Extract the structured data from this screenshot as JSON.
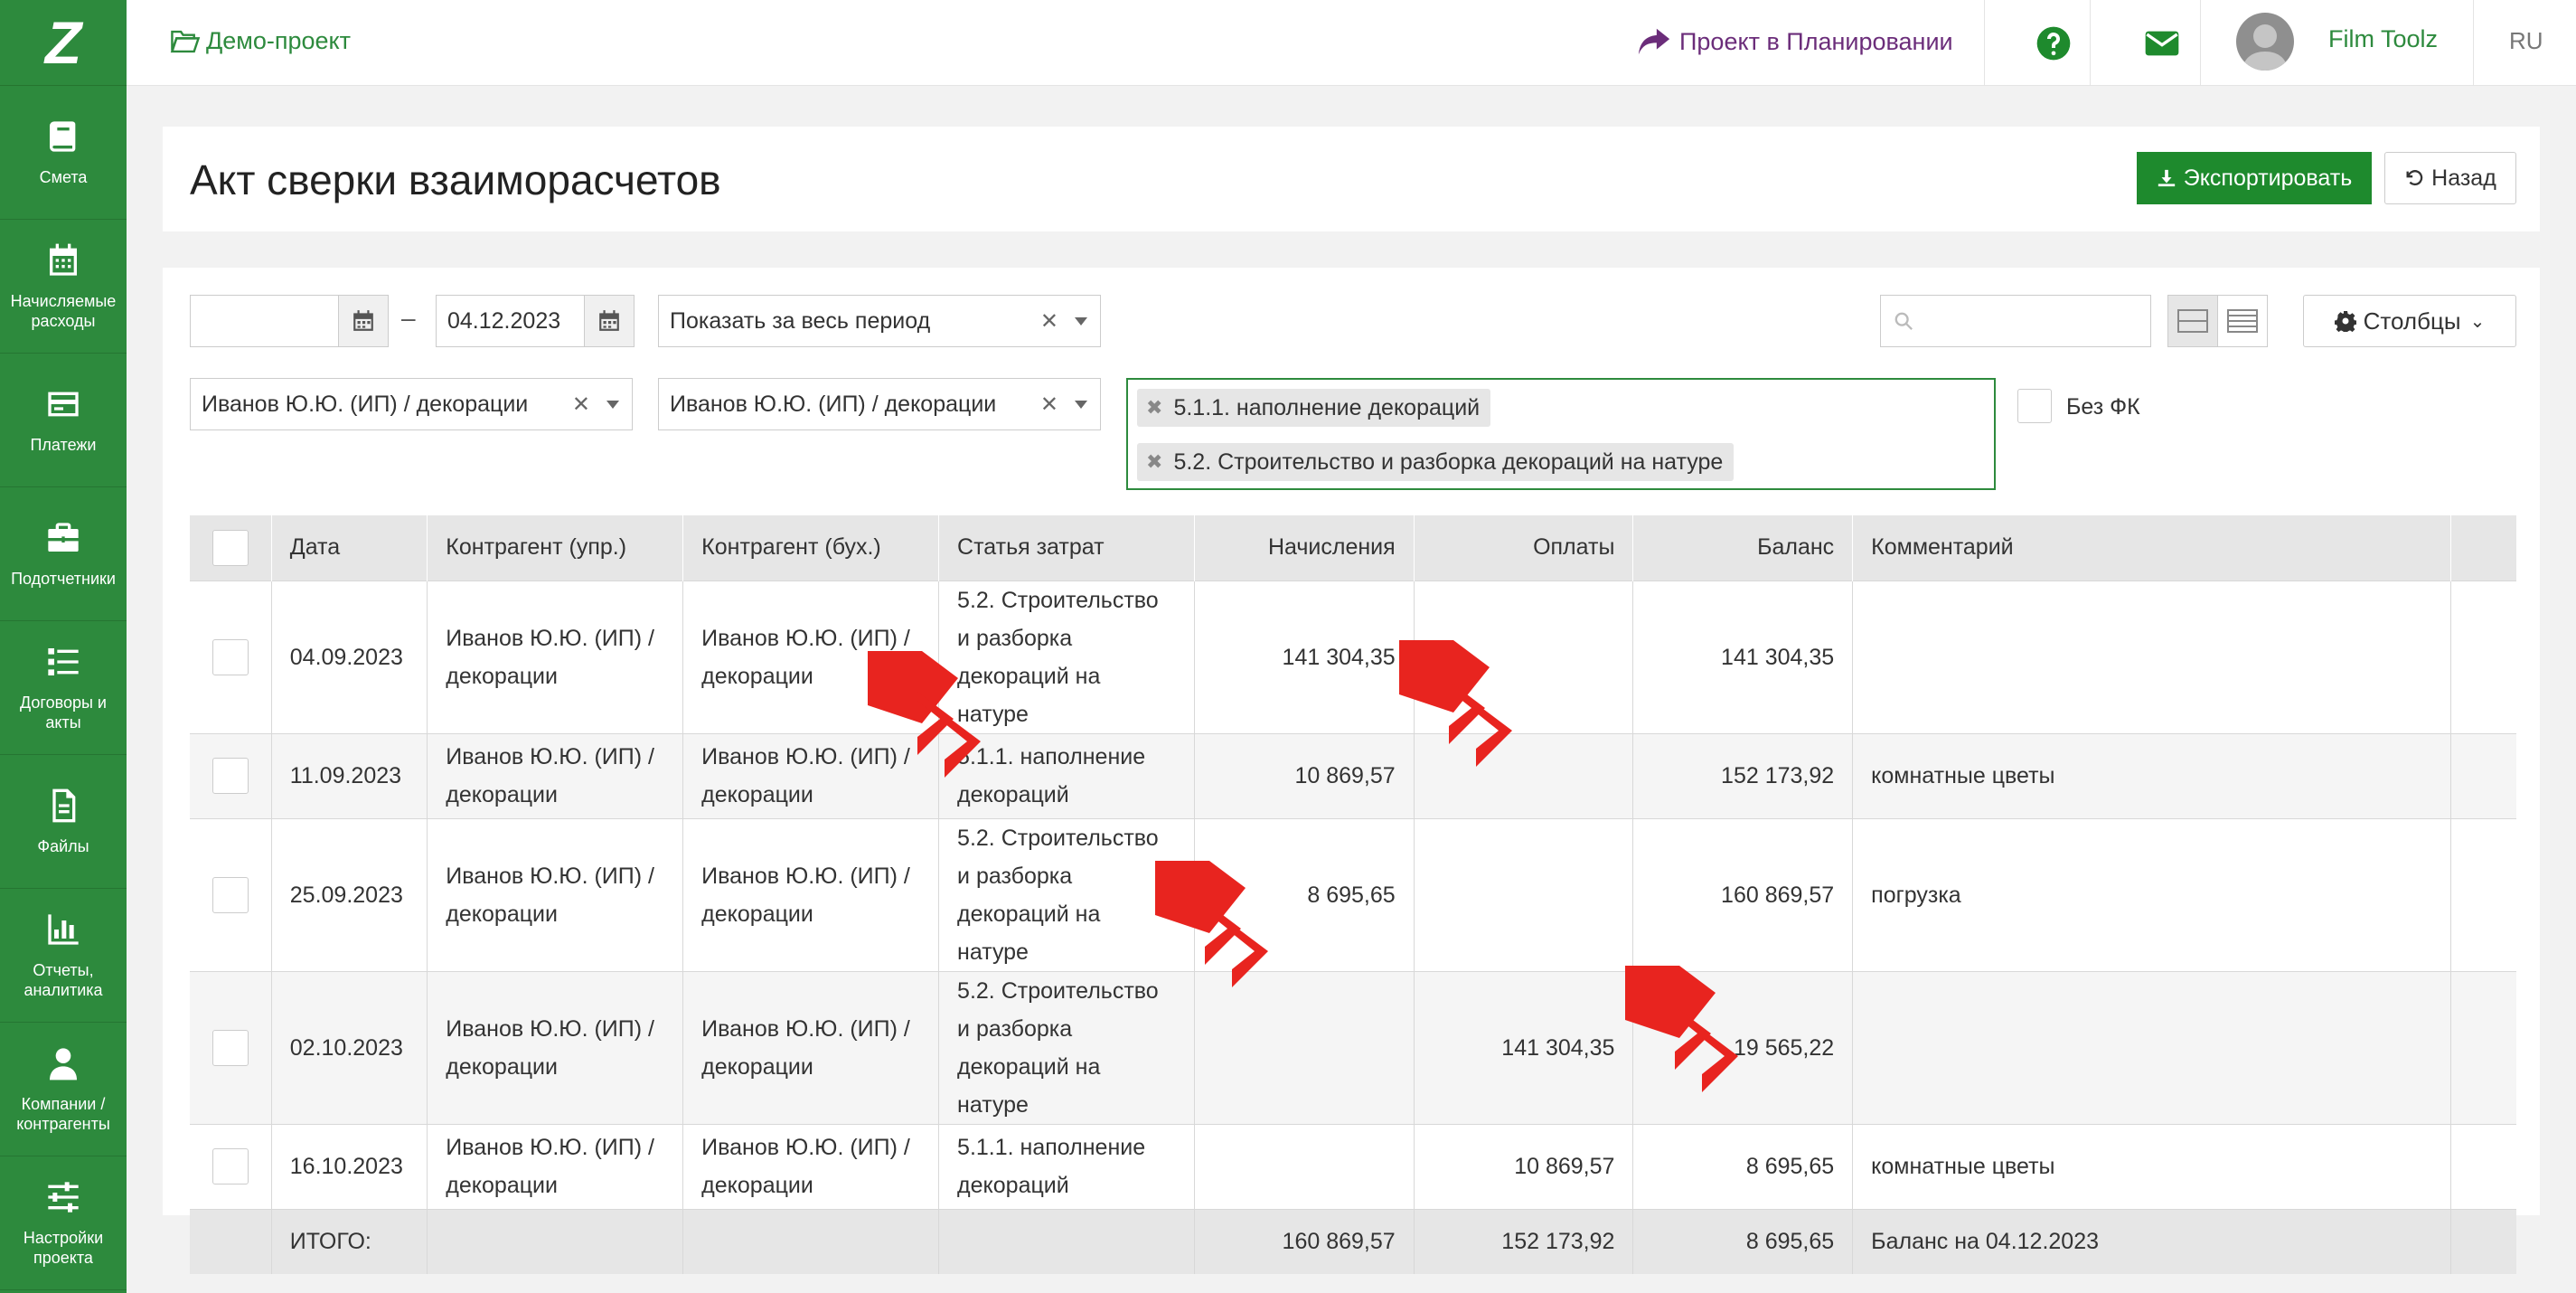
{
  "app": {
    "logo": "Z"
  },
  "sidebar": {
    "items": [
      {
        "label": "Смета",
        "icon": "book-icon"
      },
      {
        "label": "Начисляемые\nрасходы",
        "icon": "calendar-icon"
      },
      {
        "label": "Платежи",
        "icon": "card-icon"
      },
      {
        "label": "Подотчетники",
        "icon": "briefcase-icon"
      },
      {
        "label": "Договоры и\nакты",
        "icon": "list-icon"
      },
      {
        "label": "Файлы",
        "icon": "file-icon"
      },
      {
        "label": "Отчеты,\nаналитика",
        "icon": "chart-icon"
      },
      {
        "label": "Компании /\nконтрагенты",
        "icon": "user-icon"
      },
      {
        "label": "Настройки\nпроекта",
        "icon": "sliders-icon"
      }
    ]
  },
  "topbar": {
    "project": "Демо-проект",
    "status": "Проект в Планировании",
    "user": "Film Toolz",
    "lang": "RU"
  },
  "page": {
    "title": "Акт сверки взаиморасчетов",
    "export_label": "Экспортировать",
    "back_label": "Назад"
  },
  "filters": {
    "date_from": "",
    "date_to": "04.12.2023",
    "period": "Показать за весь период",
    "contractor_mgmt": "Иванов Ю.Ю. (ИП) / декорации",
    "contractor_acc": "Иванов Ю.Ю. (ИП) / декорации",
    "cost_items": [
      "5.1.1. наполнение декораций",
      "5.2. Строительство и разборка декораций на натуре"
    ],
    "no_fk_label": "Без ФК",
    "search_placeholder": "",
    "columns_label": "Столбцы"
  },
  "table": {
    "headers": [
      "Дата",
      "Контрагент (упр.)",
      "Контрагент (бух.)",
      "Статья затрат",
      "Начисления",
      "Оплаты",
      "Баланс",
      "Комментарий"
    ],
    "rows": [
      {
        "date": "04.09.2023",
        "c_mgmt": "Иванов Ю.Ю. (ИП) / декорации",
        "c_acc": "Иванов Ю.Ю. (ИП) / декорации",
        "item": "5.2. Строительство и разборка декораций на натуре",
        "accr": "141 304,35",
        "pay": "",
        "bal": "141 304,35",
        "comment": ""
      },
      {
        "date": "11.09.2023",
        "c_mgmt": "Иванов Ю.Ю. (ИП) / декорации",
        "c_acc": "Иванов Ю.Ю. (ИП) / декорации",
        "item": "5.1.1. наполнение декораций",
        "accr": "10 869,57",
        "pay": "",
        "bal": "152 173,92",
        "comment": "комнатные цветы"
      },
      {
        "date": "25.09.2023",
        "c_mgmt": "Иванов Ю.Ю. (ИП) / декорации",
        "c_acc": "Иванов Ю.Ю. (ИП) / декорации",
        "item": "5.2. Строительство и разборка декораций на натуре",
        "accr": "8 695,65",
        "pay": "",
        "bal": "160 869,57",
        "comment": "погрузка"
      },
      {
        "date": "02.10.2023",
        "c_mgmt": "Иванов Ю.Ю. (ИП) / декорации",
        "c_acc": "Иванов Ю.Ю. (ИП) / декорации",
        "item": "5.2. Строительство и разборка декораций на натуре",
        "accr": "",
        "pay": "141 304,35",
        "bal": "19 565,22",
        "comment": ""
      },
      {
        "date": "16.10.2023",
        "c_mgmt": "Иванов Ю.Ю. (ИП) / декорации",
        "c_acc": "Иванов Ю.Ю. (ИП) / декорации",
        "item": "5.1.1. наполнение декораций",
        "accr": "",
        "pay": "10 869,57",
        "bal": "8 695,65",
        "comment": "комнатные цветы"
      }
    ],
    "total": {
      "label": "ИТОГО:",
      "accr": "160 869,57",
      "pay": "152 173,92",
      "bal": "8 695,65",
      "comment": "Баланс на 04.12.2023"
    }
  },
  "colors": {
    "accent": "#2d8a3d",
    "status": "#6b2d7a",
    "marker": "#e8241f"
  }
}
